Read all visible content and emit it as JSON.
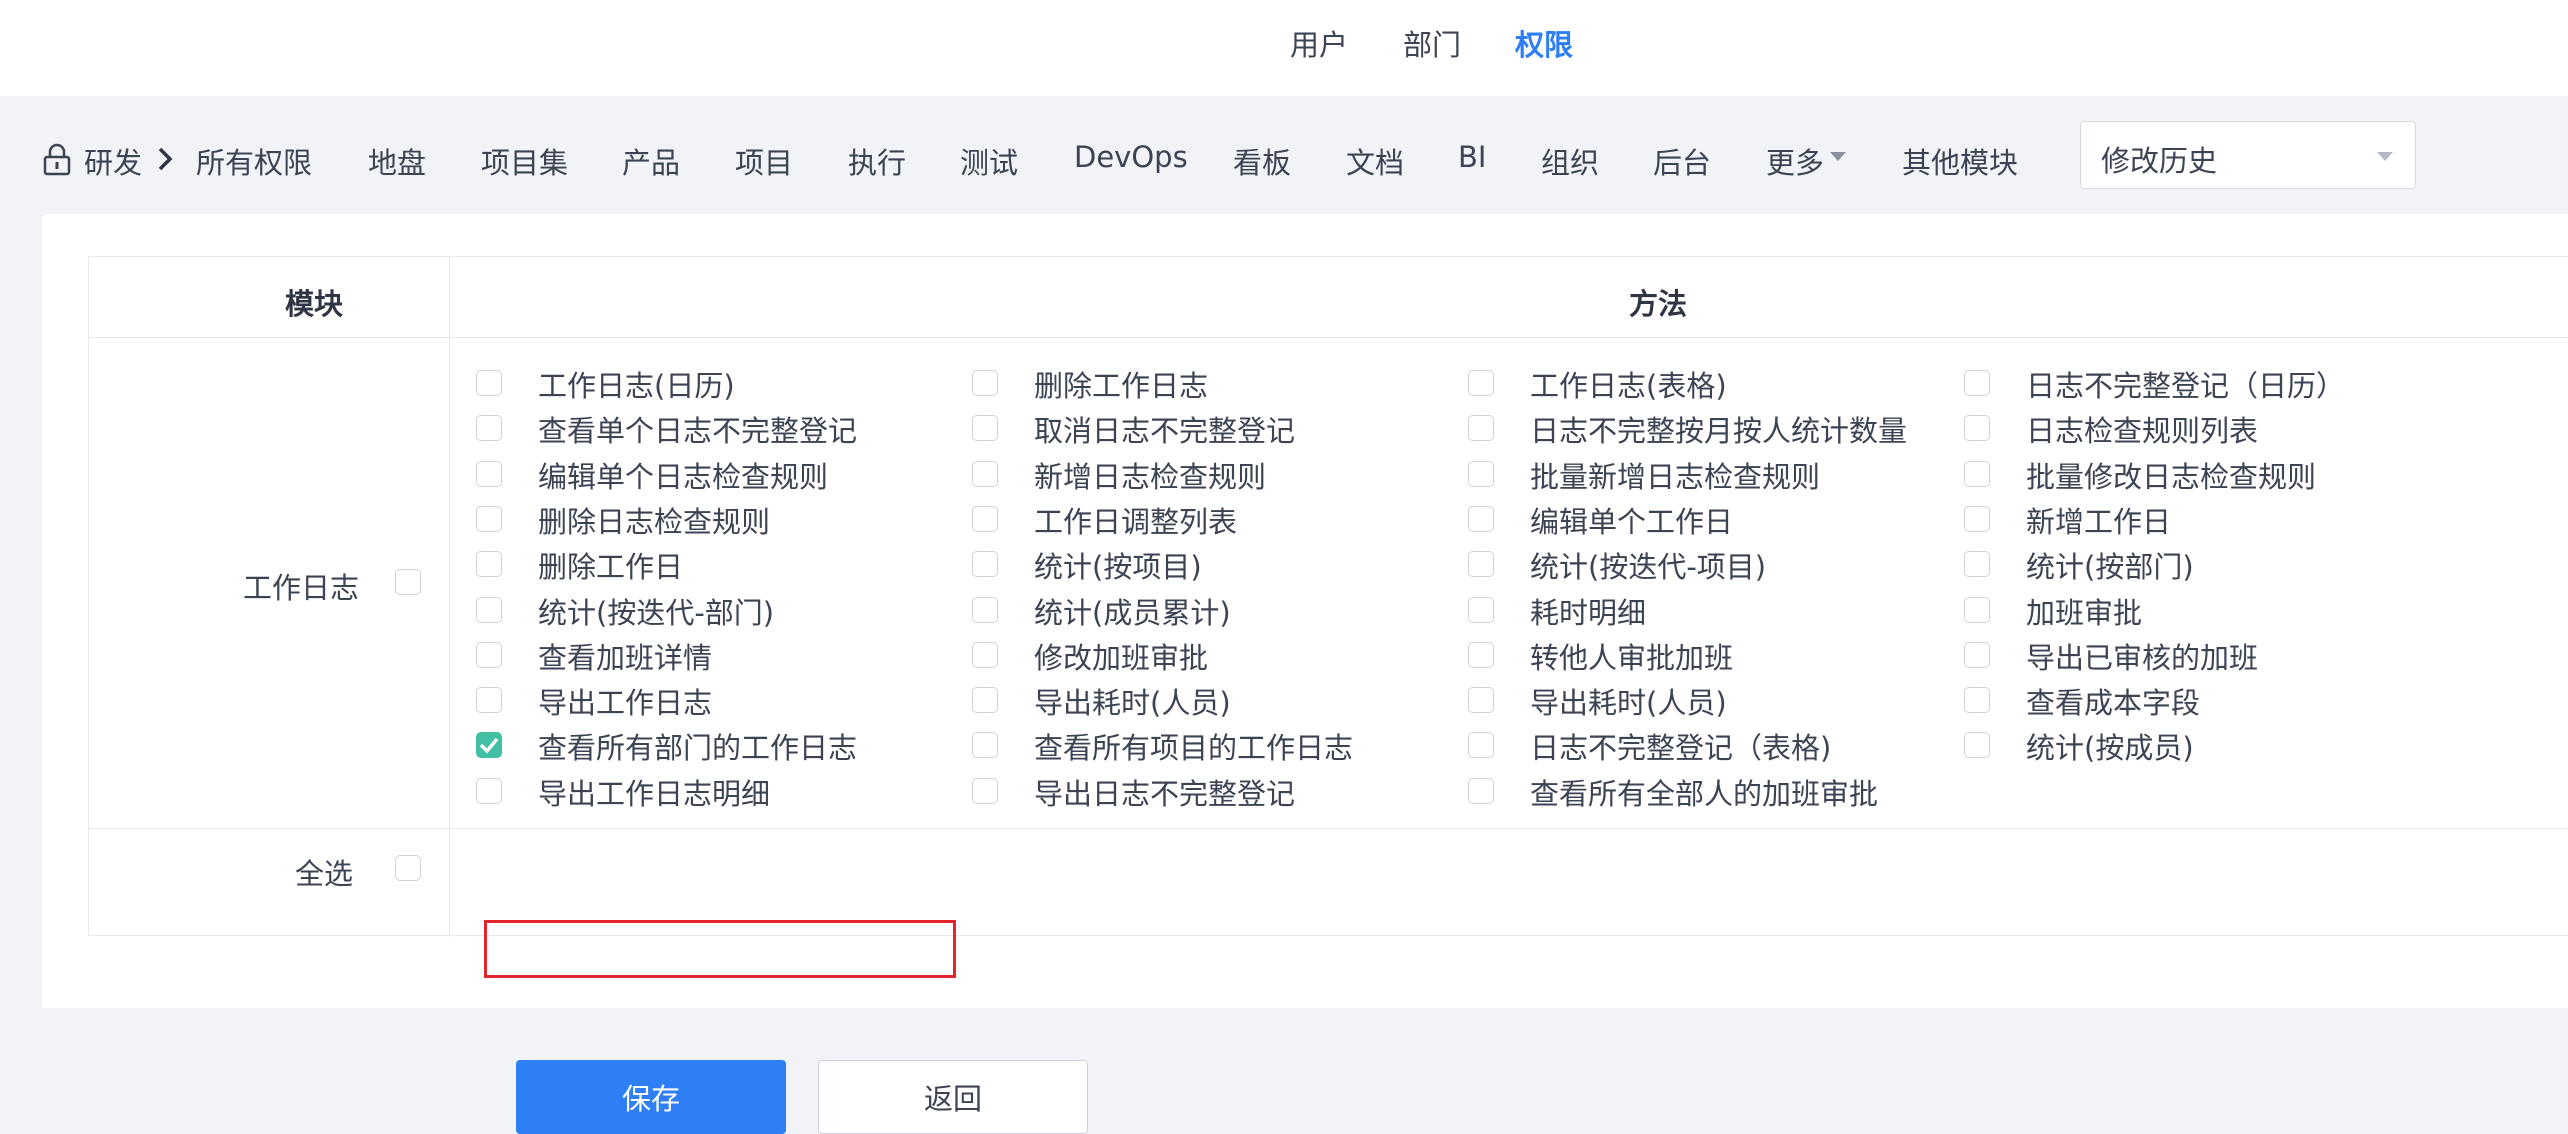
{
  "top_tabs": [
    "用户",
    "部门",
    "权限"
  ],
  "active_top_tab": "权限",
  "breadcrumb": "研发",
  "nav_items": [
    "所有权限",
    "地盘",
    "项目集",
    "产品",
    "项目",
    "执行",
    "测试",
    "DevOps",
    "看板",
    "文档",
    "BI",
    "组织",
    "后台",
    "更多",
    "其他模块"
  ],
  "history_select": {
    "value": "修改历史"
  },
  "table": {
    "col_module": "模块",
    "col_method": "方法",
    "module_name": "工作日志",
    "select_all": "全选",
    "methods": [
      [
        "工作日志(日历)",
        "删除工作日志",
        "工作日志(表格)",
        "日志不完整登记（日历）"
      ],
      [
        "查看单个日志不完整登记",
        "取消日志不完整登记",
        "日志不完整按月按人统计数量",
        "日志检查规则列表"
      ],
      [
        "编辑单个日志检查规则",
        "新增日志检查规则",
        "批量新增日志检查规则",
        "批量修改日志检查规则"
      ],
      [
        "删除日志检查规则",
        "工作日调整列表",
        "编辑单个工作日",
        "新增工作日"
      ],
      [
        "删除工作日",
        "统计(按项目)",
        "统计(按迭代-项目)",
        "统计(按部门)"
      ],
      [
        "统计(按迭代-部门)",
        "统计(成员累计)",
        "耗时明细",
        "加班审批"
      ],
      [
        "查看加班详情",
        "修改加班审批",
        "转他人审批加班",
        "导出已审核的加班"
      ],
      [
        "导出工作日志",
        "导出耗时(人员)",
        "导出耗时(人员)",
        "查看成本字段"
      ],
      [
        "查看所有部门的工作日志",
        "查看所有项目的工作日志",
        "日志不完整登记（表格)",
        "统计(按成员)"
      ],
      [
        "导出工作日志明细",
        "导出日志不完整登记",
        "查看所有全部人的加班审批",
        ""
      ]
    ],
    "checked_method": "查看所有部门的工作日志"
  },
  "buttons": {
    "save": "保存",
    "back": "返回"
  },
  "colors": {
    "accent": "#2e7ff5",
    "checked": "#43c0a4",
    "highlight": "#e0262a"
  }
}
